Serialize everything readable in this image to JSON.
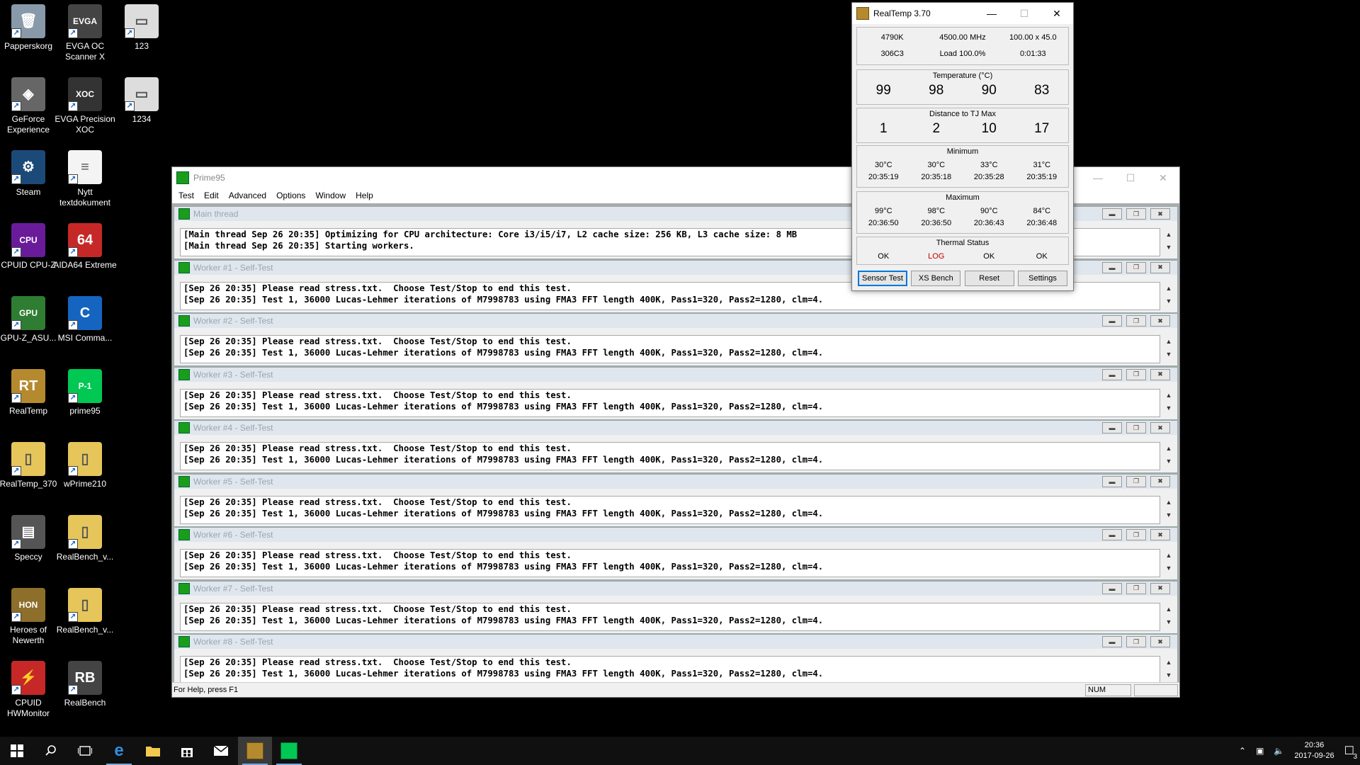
{
  "desktop": {
    "icons": [
      {
        "label": "Papperskorg",
        "col": 0,
        "row": 0,
        "color": "#8899aa",
        "glyph": "🗑"
      },
      {
        "label": "EVGA OC Scanner X",
        "col": 1,
        "row": 0,
        "color": "#444",
        "glyph": "EVGA"
      },
      {
        "label": "123",
        "col": 2,
        "row": 0,
        "color": "#ddd",
        "glyph": "▭"
      },
      {
        "label": "GeForce Experience",
        "col": 0,
        "row": 1,
        "color": "#666",
        "glyph": "◈"
      },
      {
        "label": "EVGA Precision XOC",
        "col": 1,
        "row": 1,
        "color": "#333",
        "glyph": "XOC"
      },
      {
        "label": "1234",
        "col": 2,
        "row": 1,
        "color": "#ddd",
        "glyph": "▭"
      },
      {
        "label": "Steam",
        "col": 0,
        "row": 2,
        "color": "#1b4a78",
        "glyph": "⚙"
      },
      {
        "label": "Nytt textdokument",
        "col": 1,
        "row": 2,
        "color": "#f4f4f4",
        "glyph": "≡"
      },
      {
        "label": "CPUID CPU-Z",
        "col": 0,
        "row": 3,
        "color": "#6a1b9a",
        "glyph": "CPU"
      },
      {
        "label": "AIDA64 Extreme",
        "col": 1,
        "row": 3,
        "color": "#c62828",
        "glyph": "64"
      },
      {
        "label": "GPU-Z_ASU...",
        "col": 0,
        "row": 4,
        "color": "#2e7d32",
        "glyph": "GPU"
      },
      {
        "label": "MSI Comma...",
        "col": 1,
        "row": 4,
        "color": "#1565c0",
        "glyph": "C"
      },
      {
        "label": "RealTemp",
        "col": 0,
        "row": 5,
        "color": "#b58a2e",
        "glyph": "RT"
      },
      {
        "label": "prime95",
        "col": 1,
        "row": 5,
        "color": "#00c853",
        "glyph": "P-1"
      },
      {
        "label": "RealTemp_370",
        "col": 0,
        "row": 6,
        "color": "#e6c65a",
        "glyph": "▯"
      },
      {
        "label": "wPrime210",
        "col": 1,
        "row": 6,
        "color": "#e6c65a",
        "glyph": "▯"
      },
      {
        "label": "Speccy",
        "col": 0,
        "row": 7,
        "color": "#555",
        "glyph": "▤"
      },
      {
        "label": "RealBench_v...",
        "col": 1,
        "row": 7,
        "color": "#e6c65a",
        "glyph": "▯"
      },
      {
        "label": "Heroes of Newerth",
        "col": 0,
        "row": 8,
        "color": "#8d6e2a",
        "glyph": "HON"
      },
      {
        "label": "RealBench_v...",
        "col": 1,
        "row": 8,
        "color": "#e6c65a",
        "glyph": "▯"
      },
      {
        "label": "CPUID HWMonitor",
        "col": 0,
        "row": 9,
        "color": "#c62828",
        "glyph": "⚡"
      },
      {
        "label": "RealBench",
        "col": 1,
        "row": 9,
        "color": "#444",
        "glyph": "RB"
      }
    ]
  },
  "prime95": {
    "title": "Prime95",
    "menu": [
      "Test",
      "Edit",
      "Advanced",
      "Options",
      "Window",
      "Help"
    ],
    "threads": [
      {
        "title": "Main thread",
        "line1": "[Main thread Sep 26 20:35] Optimizing for CPU architecture: Core i3/i5/i7, L2 cache size: 256 KB, L3 cache size: 8 MB",
        "line2": "[Main thread Sep 26 20:35] Starting workers."
      },
      {
        "title": "Worker #1 - Self-Test",
        "line1": "[Sep 26 20:35] Please read stress.txt.  Choose Test/Stop to end this test.",
        "line2": "[Sep 26 20:35] Test 1, 36000 Lucas-Lehmer iterations of M7998783 using FMA3 FFT length 400K, Pass1=320, Pass2=1280, clm=4."
      },
      {
        "title": "Worker #2 - Self-Test",
        "line1": "[Sep 26 20:35] Please read stress.txt.  Choose Test/Stop to end this test.",
        "line2": "[Sep 26 20:35] Test 1, 36000 Lucas-Lehmer iterations of M7998783 using FMA3 FFT length 400K, Pass1=320, Pass2=1280, clm=4."
      },
      {
        "title": "Worker #3 - Self-Test",
        "line1": "[Sep 26 20:35] Please read stress.txt.  Choose Test/Stop to end this test.",
        "line2": "[Sep 26 20:35] Test 1, 36000 Lucas-Lehmer iterations of M7998783 using FMA3 FFT length 400K, Pass1=320, Pass2=1280, clm=4."
      },
      {
        "title": "Worker #4 - Self-Test",
        "line1": "[Sep 26 20:35] Please read stress.txt.  Choose Test/Stop to end this test.",
        "line2": "[Sep 26 20:35] Test 1, 36000 Lucas-Lehmer iterations of M7998783 using FMA3 FFT length 400K, Pass1=320, Pass2=1280, clm=4."
      },
      {
        "title": "Worker #5 - Self-Test",
        "line1": "[Sep 26 20:35] Please read stress.txt.  Choose Test/Stop to end this test.",
        "line2": "[Sep 26 20:35] Test 1, 36000 Lucas-Lehmer iterations of M7998783 using FMA3 FFT length 400K, Pass1=320, Pass2=1280, clm=4."
      },
      {
        "title": "Worker #6 - Self-Test",
        "line1": "[Sep 26 20:35] Please read stress.txt.  Choose Test/Stop to end this test.",
        "line2": "[Sep 26 20:35] Test 1, 36000 Lucas-Lehmer iterations of M7998783 using FMA3 FFT length 400K, Pass1=320, Pass2=1280, clm=4."
      },
      {
        "title": "Worker #7 - Self-Test",
        "line1": "[Sep 26 20:35] Please read stress.txt.  Choose Test/Stop to end this test.",
        "line2": "[Sep 26 20:35] Test 1, 36000 Lucas-Lehmer iterations of M7998783 using FMA3 FFT length 400K, Pass1=320, Pass2=1280, clm=4."
      },
      {
        "title": "Worker #8 - Self-Test",
        "line1": "[Sep 26 20:35] Please read stress.txt.  Choose Test/Stop to end this test.",
        "line2": "[Sep 26 20:35] Test 1, 36000 Lucas-Lehmer iterations of M7998783 using FMA3 FFT length 400K, Pass1=320, Pass2=1280, clm=4."
      }
    ],
    "status": "For Help, press F1",
    "num": "NUM"
  },
  "realtemp": {
    "title": "RealTemp 3.70",
    "info_row1": [
      "4790K",
      "4500.00 MHz",
      "100.00 x 45.0"
    ],
    "info_row2": [
      "306C3",
      "Load 100.0%",
      "0:01:33"
    ],
    "temperature_label": "Temperature (°C)",
    "temperatures": [
      "99",
      "98",
      "90",
      "83"
    ],
    "distance_label": "Distance to TJ Max",
    "distances": [
      "1",
      "2",
      "10",
      "17"
    ],
    "minimum_label": "Minimum",
    "min_temps": [
      "30°C",
      "30°C",
      "33°C",
      "31°C"
    ],
    "min_times": [
      "20:35:19",
      "20:35:18",
      "20:35:28",
      "20:35:19"
    ],
    "maximum_label": "Maximum",
    "max_temps": [
      "99°C",
      "98°C",
      "90°C",
      "84°C"
    ],
    "max_times": [
      "20:36:50",
      "20:36:50",
      "20:36:43",
      "20:36:48"
    ],
    "thermal_label": "Thermal Status",
    "thermal": [
      "OK",
      "LOG",
      "OK",
      "OK"
    ],
    "log_color": "#c00000",
    "buttons": [
      "Sensor Test",
      "XS Bench",
      "Reset",
      "Settings"
    ]
  },
  "taskbar": {
    "time": "20:36",
    "date": "2017-09-26",
    "notification_count": "3"
  }
}
